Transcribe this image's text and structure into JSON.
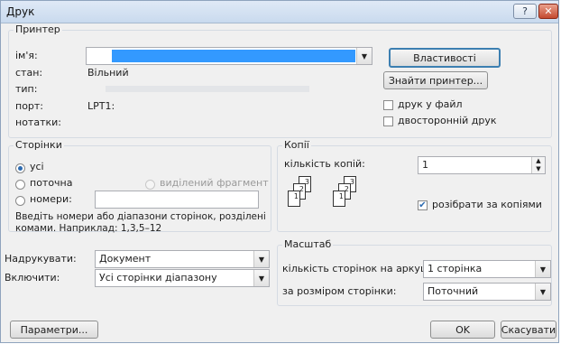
{
  "window": {
    "title": "Друк",
    "help_glyph": "?",
    "close_glyph": "✕"
  },
  "printer": {
    "legend": "Принтер",
    "name_label": "ім'я:",
    "name_value": "",
    "status_label": "стан:",
    "status_value": "Вільний",
    "type_label": "тип:",
    "type_value": "",
    "port_label": "порт:",
    "port_value": "LPT1:",
    "notes_label": "нотатки:",
    "properties_button": "Властивості",
    "find_printer_button": "Знайти принтер...",
    "print_to_file_label": "друк у файл",
    "print_to_file_checked": false,
    "duplex_label": "двосторонній друк",
    "duplex_checked": false
  },
  "pages": {
    "legend": "Сторінки",
    "all_label": "усі",
    "current_label": "поточна",
    "selection_label": "виділений фрагмент",
    "pages_label": "номери:",
    "pages_value": "",
    "selected": "all",
    "hint_line1": "Введіть номери або діапазони сторінок, розділені",
    "hint_line2": "комами. Наприклад: 1,3,5–12"
  },
  "copies": {
    "legend": "Копії",
    "count_label": "кількість копій:",
    "count_value": "1",
    "collate_label": "розібрати за копіями",
    "collate_checked": true,
    "page_numbers": [
      "1",
      "2",
      "3",
      "1",
      "2",
      "3"
    ]
  },
  "print_what": {
    "label": "Надрукувати:",
    "value": "Документ"
  },
  "include": {
    "label": "Включити:",
    "value": "Усі сторінки діапазону"
  },
  "zoom": {
    "legend": "Масштаб",
    "pages_per_sheet_label": "кількість сторінок на аркуші:",
    "pages_per_sheet_value": "1 сторінка",
    "scale_label": "за розміром сторінки:",
    "scale_value": "Поточний"
  },
  "footer": {
    "options_button": "Параметри...",
    "ok_button": "OK",
    "cancel_button": "Скасувати"
  },
  "colors": {
    "selection": "#3399ff",
    "focus_border": "#3c7fb1"
  }
}
